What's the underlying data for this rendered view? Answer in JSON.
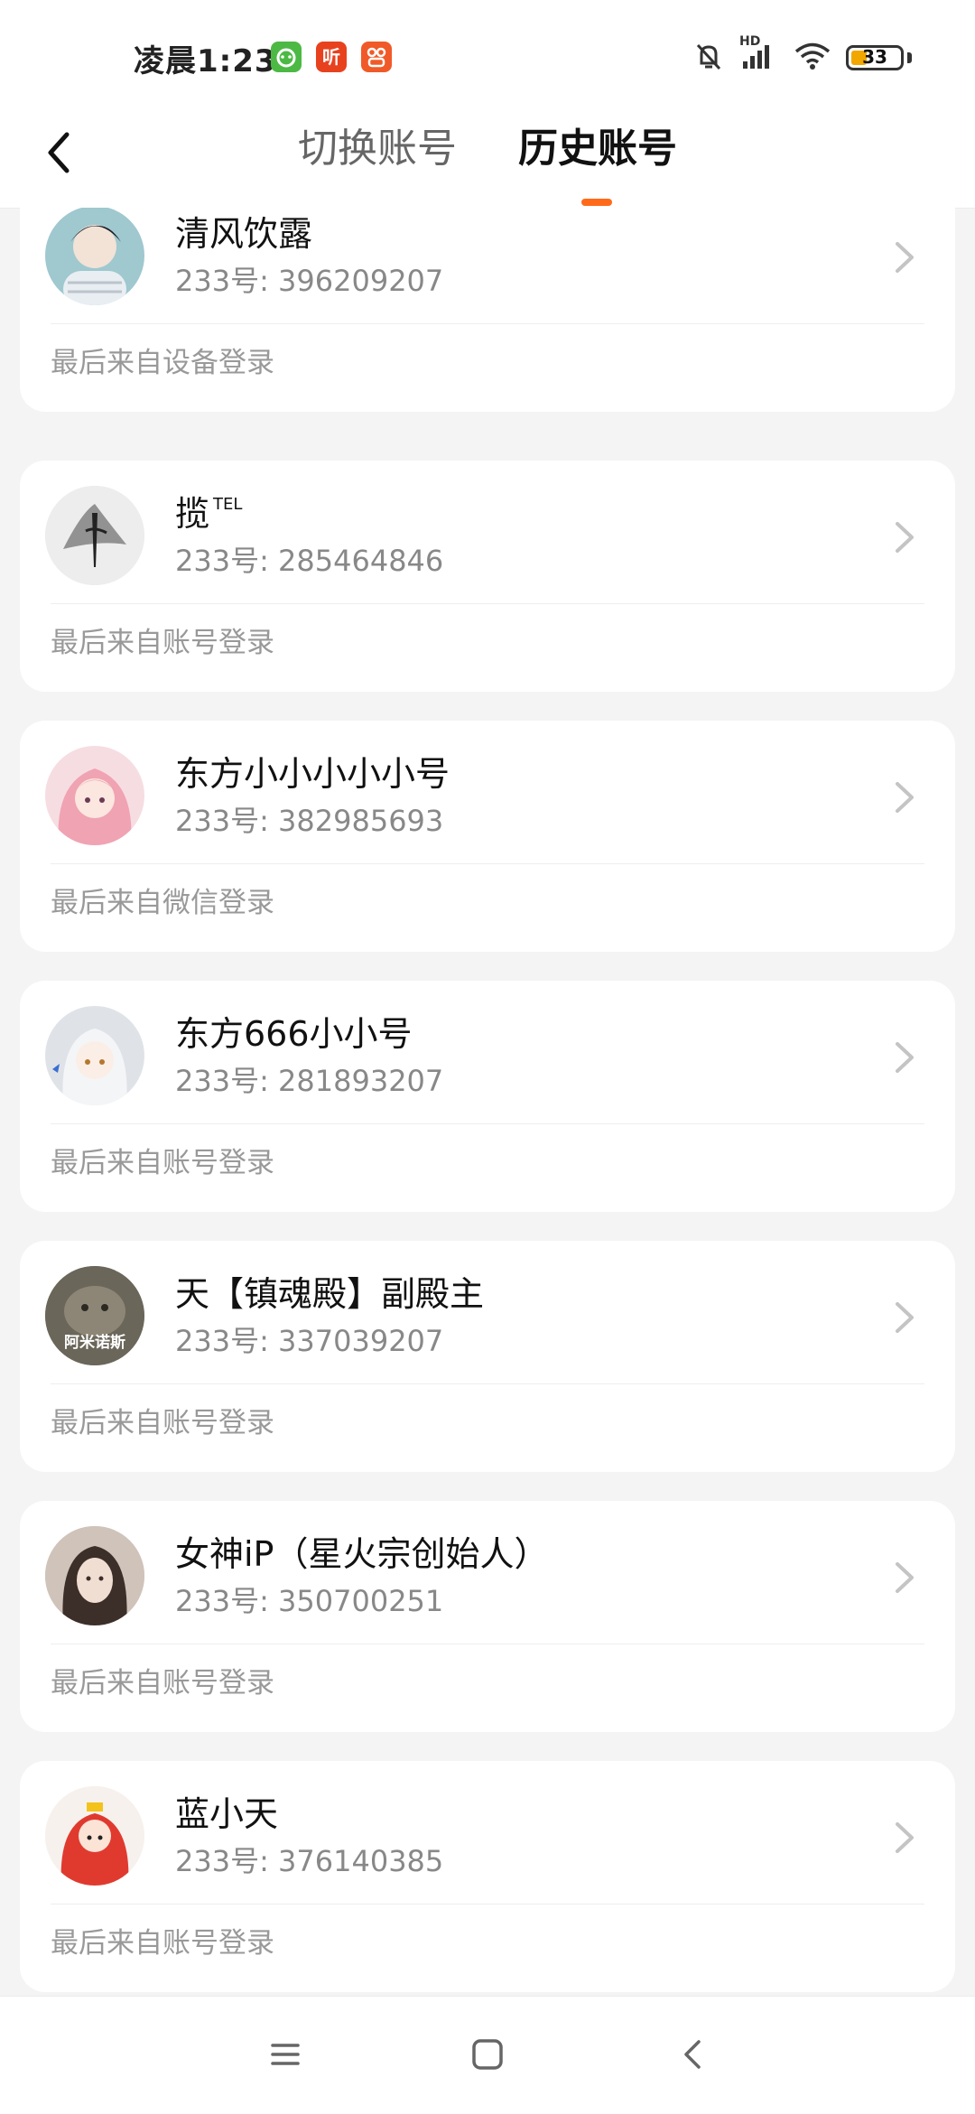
{
  "status_bar": {
    "time": "凌晨1:23",
    "app_badges": [
      {
        "icon": "android-icon",
        "color": "#4cb944"
      },
      {
        "icon": "ting-icon",
        "label": "听",
        "color": "#e8411e"
      },
      {
        "icon": "app-icon",
        "color": "#f05a28"
      }
    ],
    "network": "HD",
    "battery": "33"
  },
  "header": {
    "tabs": [
      {
        "label": "切换账号",
        "active": false
      },
      {
        "label": "历史账号",
        "active": true
      }
    ],
    "accent_color": "#ff6a1a"
  },
  "accounts": [
    {
      "name": "清风饮露",
      "uid": "233号: 396209207",
      "login_source": "最后来自设备登录",
      "avatar_color": "#9fc8cf"
    },
    {
      "name": "揽",
      "badge": "TEL",
      "uid": "233号: 285464846",
      "login_source": "最后来自账号登录",
      "avatar_color": "#c9c9c9"
    },
    {
      "name": "东方小小小小小号",
      "uid": "233号: 382985693",
      "login_source": "最后来自微信登录",
      "avatar_color": "#f1a8b4"
    },
    {
      "name": "东方666小小号",
      "uid": "233号: 281893207",
      "login_source": "最后来自账号登录",
      "avatar_color": "#d3d8df"
    },
    {
      "name": "天【镇魂殿】副殿主",
      "uid": "233号: 337039207",
      "login_source": "最后来自账号登录",
      "avatar_color": "#5c5a4e",
      "avatar_label": "阿米诺斯"
    },
    {
      "name": "女神iP（星火宗创始人）",
      "uid": "233号: 350700251",
      "login_source": "最后来自账号登录",
      "avatar_color": "#8c7b74"
    },
    {
      "name": "蓝小天",
      "uid": "233号: 376140385",
      "login_source": "最后来自账号登录",
      "avatar_color": "#e03a2f"
    }
  ],
  "nav_bar": {
    "icons": [
      "menu-icon",
      "home-icon",
      "back-icon"
    ]
  }
}
